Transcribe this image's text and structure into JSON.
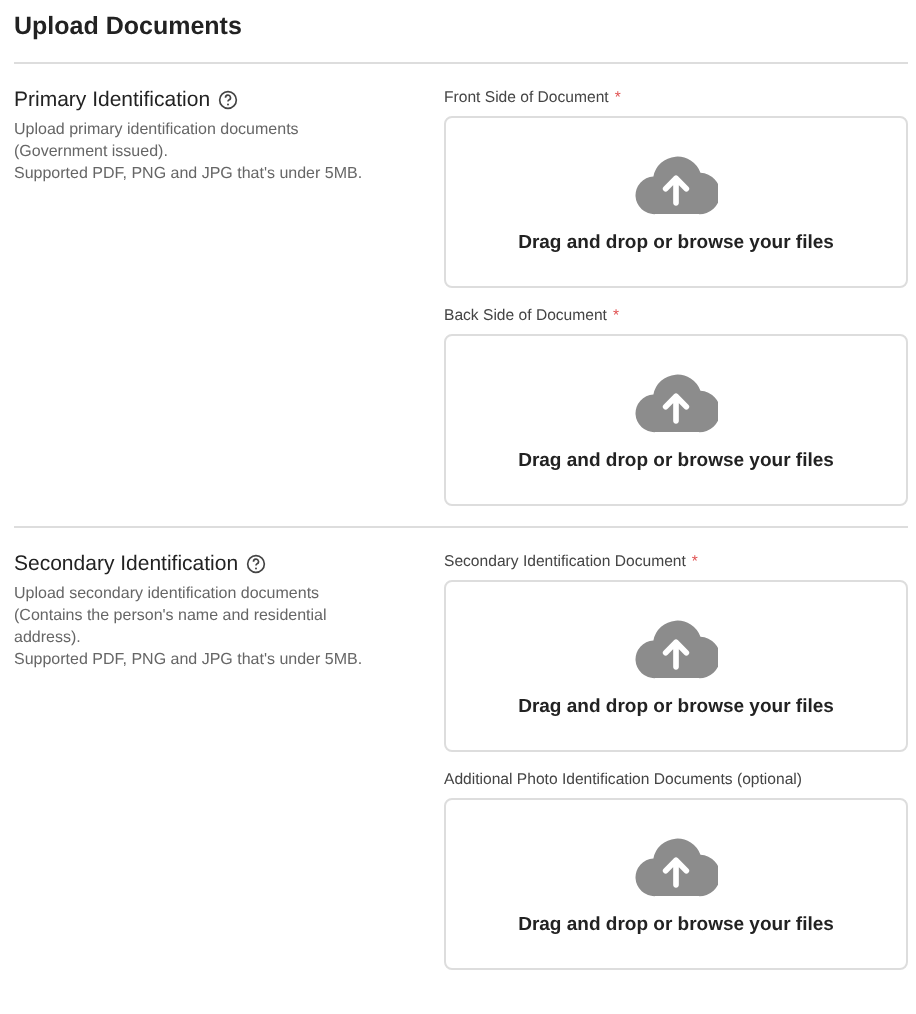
{
  "title": "Upload Documents",
  "sections": [
    {
      "heading": "Primary Identification",
      "description": [
        "Upload primary identification documents (Government issued).",
        "Supported PDF, PNG and JPG that's under 5MB."
      ],
      "uploads": [
        {
          "label": "Front Side of Document",
          "required_mark": "*",
          "prompt": "Drag and drop or browse your files"
        },
        {
          "label": "Back Side of Document",
          "required_mark": "*",
          "prompt": "Drag and drop or browse your files"
        }
      ]
    },
    {
      "heading": "Secondary Identification",
      "description": [
        "Upload secondary identification documents (Contains the person's name and residential address).",
        "Supported PDF, PNG and JPG that's under 5MB."
      ],
      "uploads": [
        {
          "label": "Secondary Identification Document",
          "required_mark": "*",
          "prompt": "Drag and drop or browse your files"
        },
        {
          "label": "Additional Photo Identification Documents (optional)",
          "prompt": "Drag and drop or browse your files"
        }
      ]
    }
  ]
}
